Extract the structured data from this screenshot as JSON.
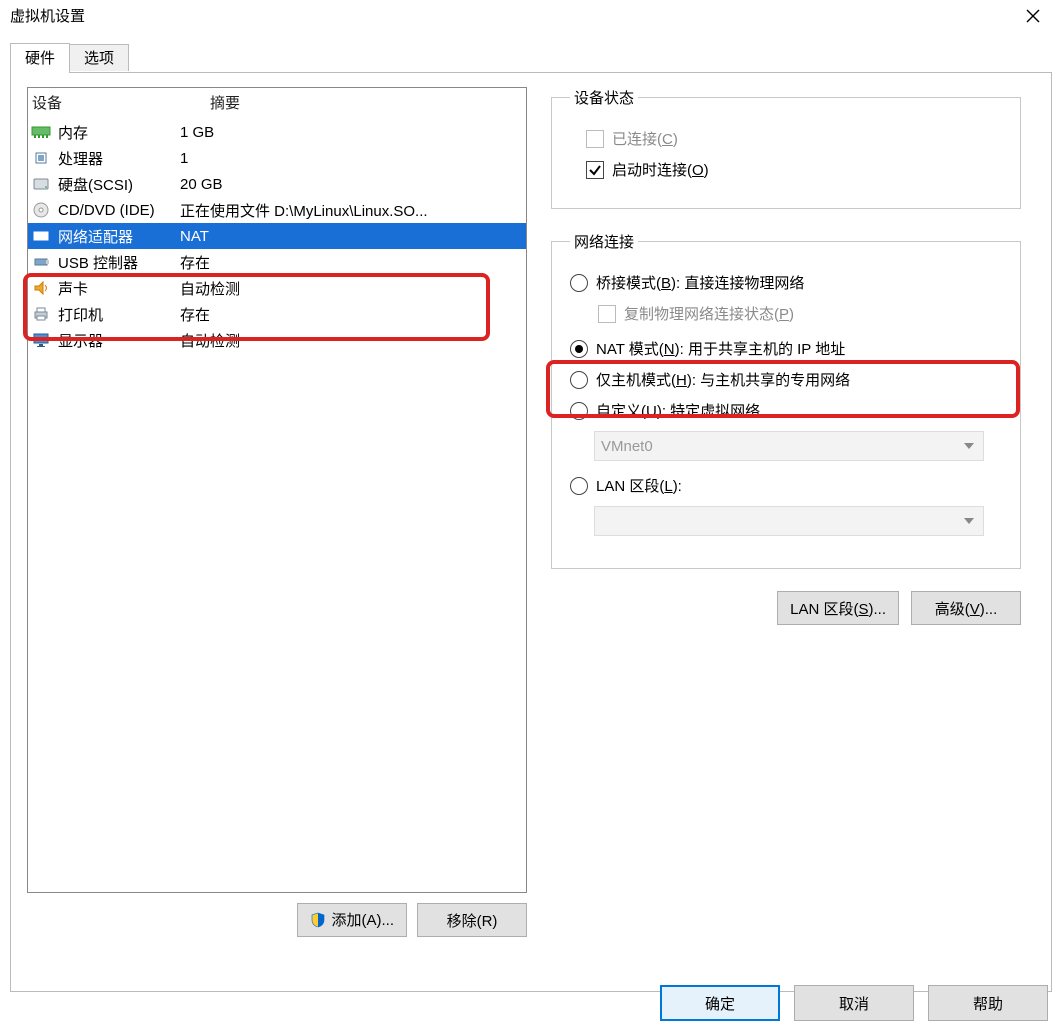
{
  "window": {
    "title": "虚拟机设置"
  },
  "tabs": {
    "hardware": "硬件",
    "options": "选项"
  },
  "device_table": {
    "header_device": "设备",
    "header_summary": "摘要",
    "rows": [
      {
        "icon": "memory-icon",
        "name": "内存",
        "summary": "1 GB"
      },
      {
        "icon": "cpu-icon",
        "name": "处理器",
        "summary": "1"
      },
      {
        "icon": "disk-icon",
        "name": "硬盘(SCSI)",
        "summary": "20 GB"
      },
      {
        "icon": "cd-icon",
        "name": "CD/DVD (IDE)",
        "summary": "正在使用文件 D:\\MyLinux\\Linux.SO..."
      },
      {
        "icon": "nic-icon",
        "name": "网络适配器",
        "summary": "NAT",
        "selected": true
      },
      {
        "icon": "usb-icon",
        "name": "USB 控制器",
        "summary": "存在"
      },
      {
        "icon": "sound-icon",
        "name": "声卡",
        "summary": "自动检测"
      },
      {
        "icon": "printer-icon",
        "name": "打印机",
        "summary": "存在"
      },
      {
        "icon": "display-icon",
        "name": "显示器",
        "summary": "自动检测"
      }
    ],
    "add_button": "添加(A)...",
    "remove_button": "移除(R)"
  },
  "device_state": {
    "legend": "设备状态",
    "connected": "已连接(C)",
    "connect_at_power_on": "启动时连接(O)"
  },
  "net_conn": {
    "legend": "网络连接",
    "bridged": "桥接模式(B): 直接连接物理网络",
    "replicate": "复制物理网络连接状态(P)",
    "nat": "NAT 模式(N): 用于共享主机的 IP 地址",
    "hostonly": "仅主机模式(H): 与主机共享的专用网络",
    "custom": "自定义(U): 特定虚拟网络",
    "custom_vnet": "VMnet0",
    "lanseg": "LAN 区段(L):",
    "lanseg_value": "",
    "btn_lanseg": "LAN 区段(S)...",
    "btn_advanced": "高级(V)..."
  },
  "footer": {
    "ok": "确定",
    "cancel": "取消",
    "help": "帮助"
  }
}
